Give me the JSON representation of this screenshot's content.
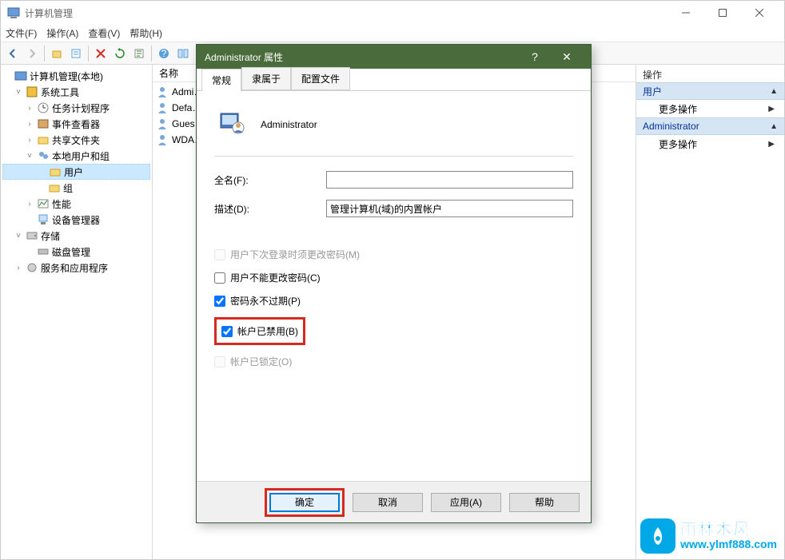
{
  "window": {
    "title": "计算机管理"
  },
  "menu": {
    "file": "文件(F)",
    "action": "操作(A)",
    "view": "查看(V)",
    "help": "帮助(H)"
  },
  "tree": {
    "root": "计算机管理(本地)",
    "systools": "系统工具",
    "taskScheduler": "任务计划程序",
    "eventViewer": "事件查看器",
    "sharedFolders": "共享文件夹",
    "localUsersGroups": "本地用户和组",
    "users": "用户",
    "groups": "组",
    "performance": "性能",
    "deviceManager": "设备管理器",
    "storage": "存储",
    "diskMgmt": "磁盘管理",
    "servicesApps": "服务和应用程序"
  },
  "list": {
    "header": "名称",
    "items": [
      "Admi…",
      "Defa…",
      "Gues…",
      "WDA…"
    ]
  },
  "actions": {
    "header": "操作",
    "group1": "用户",
    "more1": "更多操作",
    "group2": "Administrator",
    "more2": "更多操作"
  },
  "dialog": {
    "title": "Administrator 属性",
    "tabs": {
      "general": "常规",
      "memberOf": "隶属于",
      "profile": "配置文件"
    },
    "userName": "Administrator",
    "fullNameLabel": "全名(F):",
    "fullNameValue": "",
    "descLabel": "描述(D):",
    "descValue": "管理计算机(域)的内置帐户",
    "chkMustChange": "用户下次登录时须更改密码(M)",
    "chkCantChange": "用户不能更改密码(C)",
    "chkNeverExpire": "密码永不过期(P)",
    "chkDisabled": "帐户已禁用(B)",
    "chkLocked": "帐户已锁定(O)",
    "btnOk": "确定",
    "btnCancel": "取消",
    "btnApply": "应用(A)",
    "btnHelp": "帮助"
  },
  "watermark": {
    "cn": "雨林木风",
    "url": "www.ylmf888.com"
  }
}
